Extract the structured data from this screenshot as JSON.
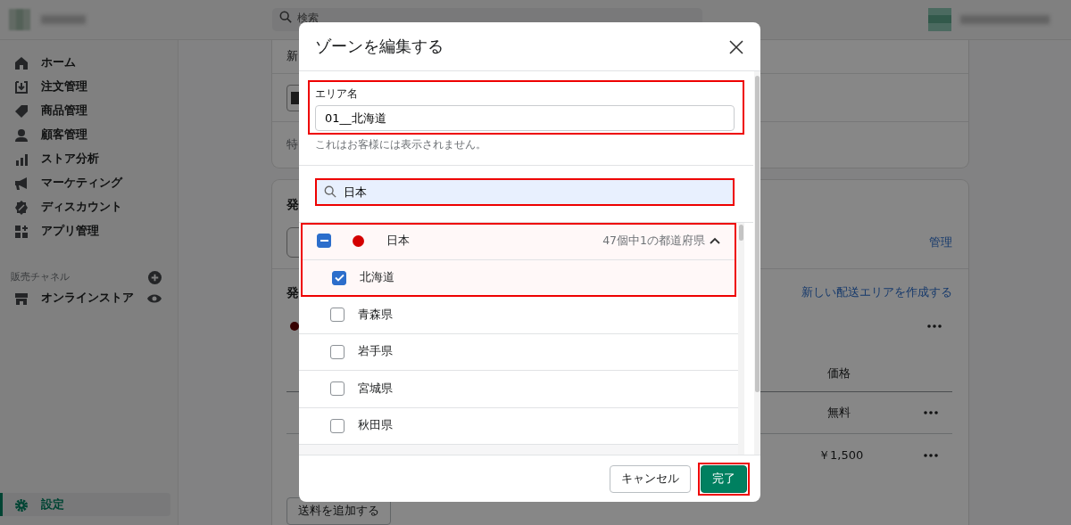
{
  "topbar": {
    "search": {
      "placeholder": "検索"
    }
  },
  "sidebar": {
    "items": [
      {
        "label": "ホーム",
        "selected": false
      },
      {
        "label": "注文管理",
        "selected": false
      },
      {
        "label": "商品管理",
        "selected": false
      },
      {
        "label": "顧客管理",
        "selected": false
      },
      {
        "label": "ストア分析",
        "selected": false
      },
      {
        "label": "マーケティング",
        "selected": false
      },
      {
        "label": "ディスカウント",
        "selected": false
      },
      {
        "label": "アプリ管理",
        "selected": false
      }
    ],
    "channels_heading": "販売チャネル",
    "channels": [
      {
        "label": "オンラインストア"
      }
    ],
    "settings": {
      "label": "設定",
      "selected": true
    }
  },
  "background": {
    "card_1": {
      "text_1": "新",
      "text_2": "特"
    },
    "card_2": {
      "heading_1": "発",
      "manage_link": "管理",
      "heading_2": "発",
      "create_link": "新しい配送エリアを作成する",
      "price_header": "価格",
      "rates": [
        {
          "price": "無料"
        },
        {
          "price": "￥1,500"
        }
      ],
      "add_rate_button": "送料を追加する"
    }
  },
  "modal": {
    "title": "ゾーンを編集する",
    "area_name": {
      "label": "エリア名",
      "value": "01__北海道",
      "help": "これはお客様には表示されません。",
      "highlighted": true
    },
    "search": {
      "value": "日本",
      "highlighted": true
    },
    "countries": [
      {
        "name": "日本",
        "color": "#d40000",
        "checked": true,
        "partial": true,
        "count": "47個中1の都道府県",
        "expanded": true,
        "highlighted": true,
        "children": [
          {
            "name": "北海道",
            "checked": true,
            "highlighted": true
          },
          {
            "name": "青森県",
            "checked": false,
            "highlighted": false
          },
          {
            "name": "岩手県",
            "checked": false,
            "highlighted": false
          },
          {
            "name": "宮城県",
            "checked": false,
            "highlighted": false
          },
          {
            "name": "秋田県",
            "checked": false,
            "highlighted": false
          }
        ]
      }
    ],
    "buttons": [
      {
        "label": "キャンセル",
        "kind": "secondary",
        "highlighted": false
      },
      {
        "label": "完了",
        "kind": "primary",
        "highlighted": true
      }
    ]
  }
}
